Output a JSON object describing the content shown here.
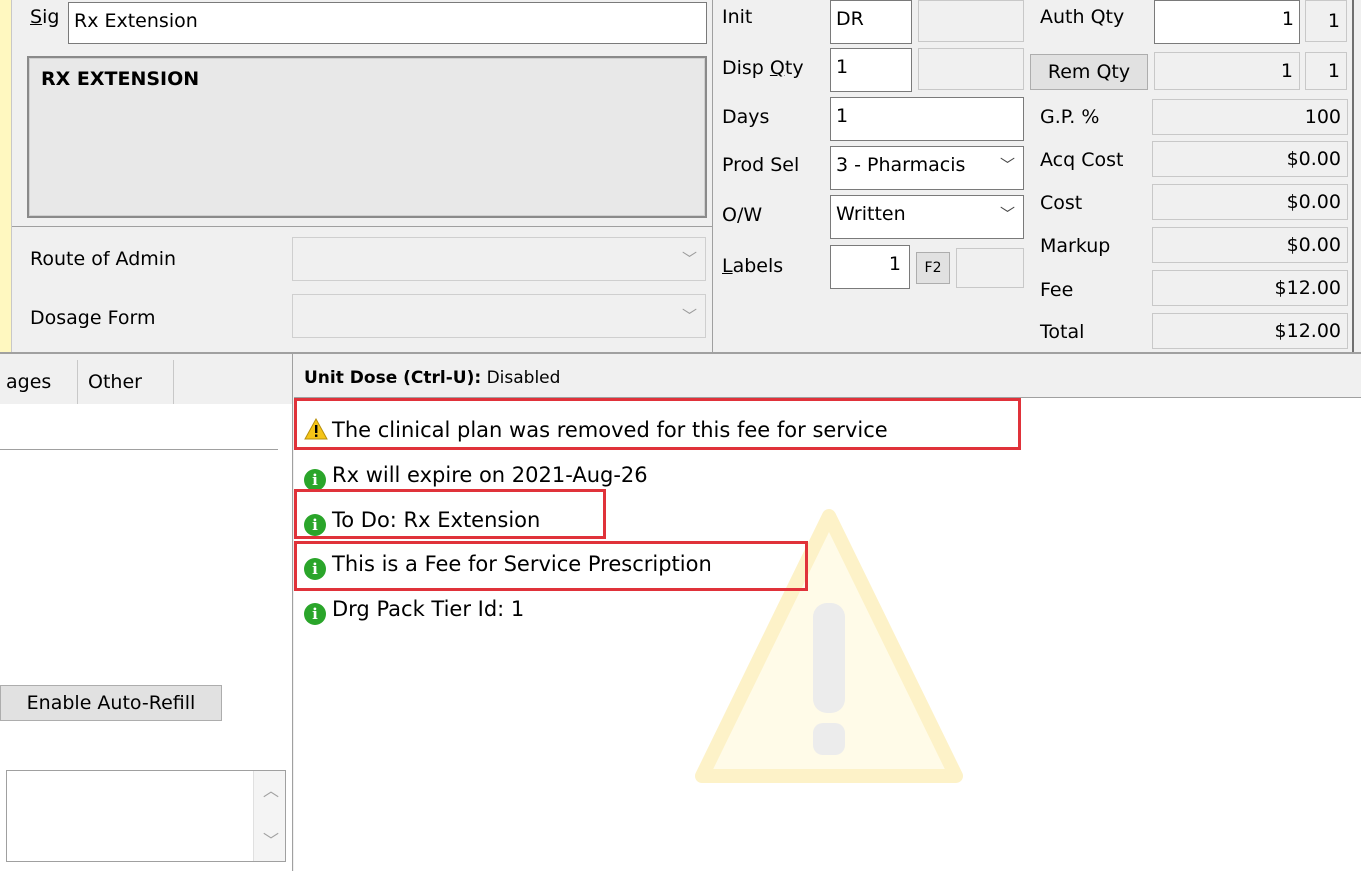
{
  "sig": {
    "label": "Sig",
    "value": "Rx Extension",
    "text": "RX EXTENSION"
  },
  "route_of_admin": {
    "label": "Route of Admin",
    "value": ""
  },
  "dosage_form": {
    "label": "Dosage Form",
    "value": ""
  },
  "middle": {
    "init": {
      "label": "Init",
      "value": "DR"
    },
    "disp_qty": {
      "label": "Disp Qty",
      "value": "1"
    },
    "days": {
      "label": "Days",
      "value": "1"
    },
    "prod_sel": {
      "label": "Prod Sel",
      "value": "3 - Pharmacis"
    },
    "ow": {
      "label": "O/W",
      "value": "Written"
    },
    "labels": {
      "label": "Labels",
      "value": "1",
      "f2_label": "F2"
    }
  },
  "pricing": {
    "auth_qty": {
      "label": "Auth Qty",
      "value": "1",
      "value2": "1"
    },
    "rem_qty": {
      "label": "Rem Qty",
      "value": "1",
      "value2": "1"
    },
    "gp_pct": {
      "label": "G.P. %",
      "value": "100"
    },
    "acq_cost": {
      "label": "Acq Cost",
      "value": "$0.00"
    },
    "cost": {
      "label": "Cost",
      "value": "$0.00"
    },
    "markup": {
      "label": "Markup",
      "value": "$0.00"
    },
    "fee": {
      "label": "Fee",
      "value": "$12.00"
    },
    "total": {
      "label": "Total",
      "value": "$12.00"
    }
  },
  "tabs": {
    "images": "ages",
    "other": "Other"
  },
  "auto_refill_button": "Enable Auto-Refill",
  "unit_dose": {
    "label": "Unit Dose (Ctrl-U):",
    "value": "Disabled"
  },
  "messages": [
    {
      "icon": "warning-icon",
      "text": "The clinical plan was removed for this fee for service"
    },
    {
      "icon": "info-icon",
      "text": "Rx will expire on 2021-Aug-26"
    },
    {
      "icon": "info-icon",
      "text": "To Do: Rx Extension"
    },
    {
      "icon": "info-icon",
      "text": "This is a Fee for Service Prescription"
    },
    {
      "icon": "info-icon",
      "text": "Drg Pack Tier Id: 1"
    }
  ],
  "colors": {
    "highlight_border": "#e0323a",
    "info_green": "#2aa52a",
    "warning_yellow": "#f5c518",
    "left_accent": "#fff8c0"
  }
}
